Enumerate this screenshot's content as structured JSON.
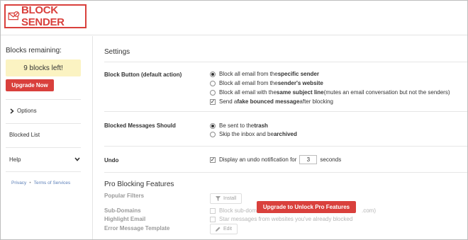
{
  "brand": {
    "name": "BLOCK SENDER",
    "color": "#d9403c"
  },
  "sidebar": {
    "blocks_title": "Blocks remaining:",
    "blocks_left": "9 blocks left!",
    "upgrade_label": "Upgrade Now",
    "items": [
      {
        "label": "Options",
        "icon": "chevron-right-icon"
      },
      {
        "label": "Blocked List"
      },
      {
        "label": "Help",
        "icon": "chevron-down-icon"
      }
    ],
    "links": {
      "privacy": "Privacy",
      "separator": "•",
      "terms": "Terms of Services"
    }
  },
  "settings": {
    "title": "Settings",
    "block_button": {
      "label": "Block Button (default action)",
      "options": [
        {
          "pre": "Block all email from the ",
          "bold": "specific sender",
          "post": "",
          "selected": true
        },
        {
          "pre": "Block all email from the ",
          "bold": "sender's website",
          "post": "",
          "selected": false
        },
        {
          "pre": "Block all email with the ",
          "bold": "same subject line",
          "post": " (mutes an email conversation but not the senders)",
          "selected": false
        }
      ],
      "fake_bounce": {
        "pre": "Send a ",
        "bold": "fake bounced message",
        "post": " after blocking",
        "checked": true
      }
    },
    "blocked_messages": {
      "label": "Blocked Messages Should",
      "options": [
        {
          "pre": "Be sent to the ",
          "bold": "trash",
          "post": "",
          "selected": true
        },
        {
          "pre": "Skip the inbox and be ",
          "bold": "archived",
          "post": "",
          "selected": false
        }
      ]
    },
    "undo": {
      "label": "Undo",
      "text_before": "Display an undo notification for",
      "value": "3",
      "text_after": "seconds",
      "checked": true
    }
  },
  "pro": {
    "title": "Pro Blocking Features",
    "popular_filters": {
      "label": "Popular Filters",
      "button": "Install"
    },
    "sub_domains": {
      "label": "Sub-Domains",
      "text": "Block sub-doma",
      "text_tail": ".com)"
    },
    "highlight_email": {
      "label": "Highlight Email",
      "text": "Star messages from websites you've already blocked"
    },
    "error_template": {
      "label": "Error Message Template",
      "button": "Edit"
    },
    "upgrade_label": "Upgrade to Unlock Pro Features"
  }
}
